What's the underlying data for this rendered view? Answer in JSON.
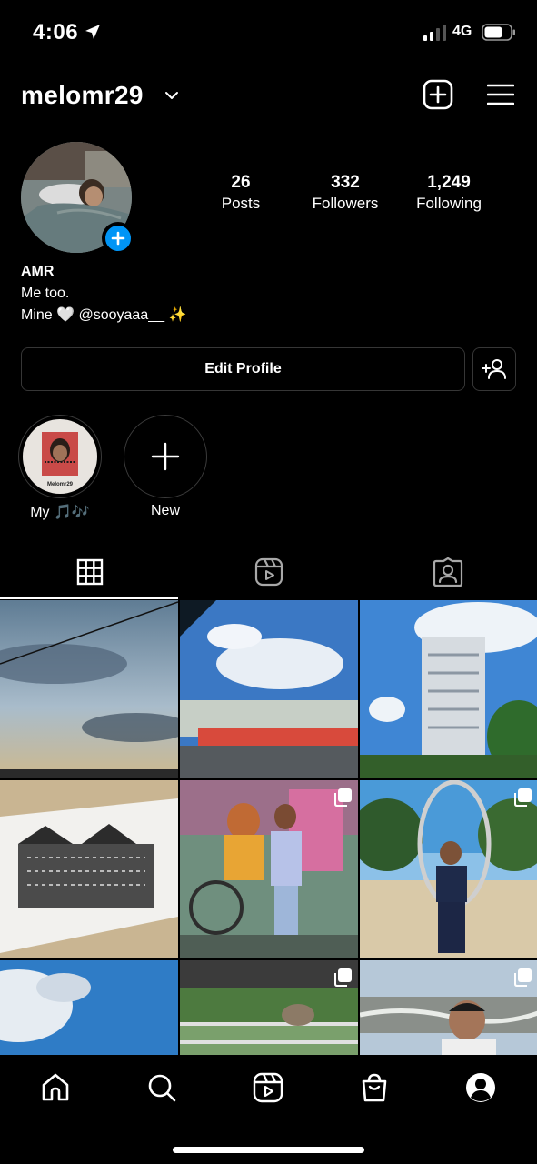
{
  "status_bar": {
    "time": "4:06",
    "network": "4G",
    "icons": [
      "location-arrow-icon",
      "signal-icon",
      "battery-icon"
    ]
  },
  "header": {
    "username": "melomr29",
    "icons": [
      "chevron-down-icon",
      "add-post-icon",
      "menu-icon"
    ]
  },
  "profile": {
    "stats": [
      {
        "value": "26",
        "label": "Posts"
      },
      {
        "value": "332",
        "label": "Followers"
      },
      {
        "value": "1,249",
        "label": "Following"
      }
    ],
    "name": "AMR",
    "bio_lines": [
      "Me too.",
      "Mine 🤍 @sooyaaa__ ✨"
    ]
  },
  "actions": {
    "edit_profile_label": "Edit Profile"
  },
  "highlights": [
    {
      "label": "My 🎵🎶",
      "cover_text": "Melomr29"
    },
    {
      "label": "New"
    }
  ],
  "tabs": [
    {
      "name": "posts",
      "icon": "grid-icon",
      "active": true
    },
    {
      "name": "reels",
      "icon": "reels-icon",
      "active": false
    },
    {
      "name": "tagged",
      "icon": "tagged-icon",
      "active": false
    }
  ],
  "bottom_nav": [
    "home-icon",
    "search-icon",
    "reels-icon",
    "shop-icon",
    "profile-icon"
  ],
  "colors": {
    "accent_blue": "#0095f6",
    "background": "#000000",
    "border": "#363636"
  }
}
